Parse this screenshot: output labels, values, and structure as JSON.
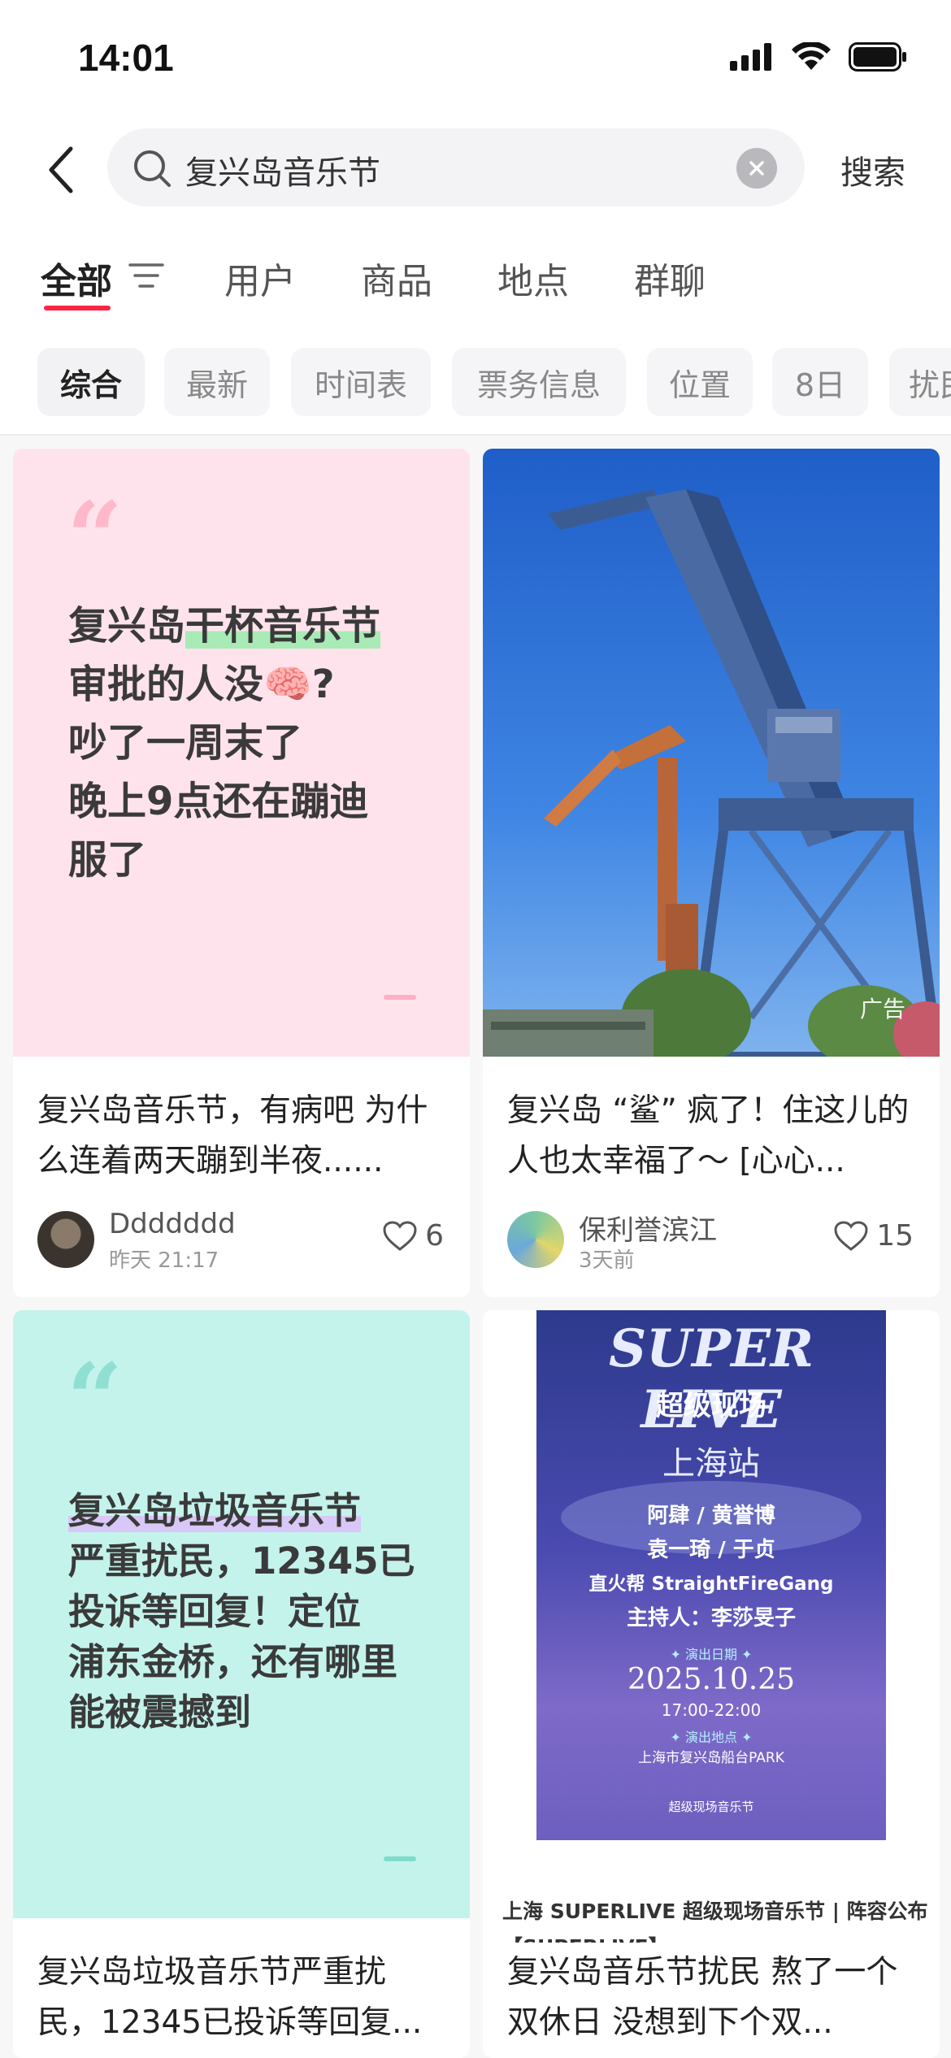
{
  "status": {
    "time": "14:01"
  },
  "search": {
    "query": "复兴岛音乐节",
    "button": "搜索"
  },
  "tabs": [
    "全部",
    "用户",
    "商品",
    "地点",
    "群聊"
  ],
  "chips": [
    "综合",
    "最新",
    "时间表",
    "票务信息",
    "位置",
    "8日",
    "扰民"
  ],
  "cards": [
    {
      "cover_lines": [
        "复兴岛",
        "干杯音乐节",
        "审批的人没🧠?",
        "吵了一周末了",
        "晚上9点还在蹦迪",
        "服了"
      ],
      "title": "复兴岛音乐节，有病吧 为什么连着两天蹦到半夜......",
      "author": "Ddddddd",
      "time": "昨天 21:17",
      "likes": "6"
    },
    {
      "ad": "广告",
      "title": "复兴岛 “鲨” 疯了！住这儿的人也太幸福了～ [心心...",
      "author": "保利誉滨江",
      "time": "3天前",
      "likes": "15"
    },
    {
      "cover_lines": [
        "复兴岛垃圾音乐节",
        "严重扰民，12345已",
        "投诉等回复！定位",
        "浦东金桥，还有哪里",
        "能被震撼到"
      ],
      "title": "复兴岛垃圾音乐节严重扰民，12345已投诉等回复..."
    },
    {
      "poster": {
        "logo": "SUPER LIVE",
        "subtitle": "超级现场",
        "city": "上海站",
        "lineup": [
          "阿肆 / 黄誉博",
          "袁一琦 / 于贞",
          "直火帮 StraightFireGang",
          "主持人：李莎旻子"
        ],
        "date_label": "✦ 演出日期 ✦",
        "date": "2025.10.25",
        "hours": "17:00-22:00",
        "venue_label": "✦ 演出地点 ✦",
        "venue": "上海市复兴岛船台PARK",
        "footer": "超级现场音乐节"
      },
      "caption": "上海 SUPERLIVE 超级现场音乐节 | 阵容公布【SUPERLIVE】",
      "title": "复兴岛音乐节扰民 熬了一个双休日 没想到下个双..."
    }
  ],
  "colors": {
    "accent": "#ff2442",
    "pink_card": "#ffe3ec",
    "mint_card": "#c4f3ec"
  }
}
